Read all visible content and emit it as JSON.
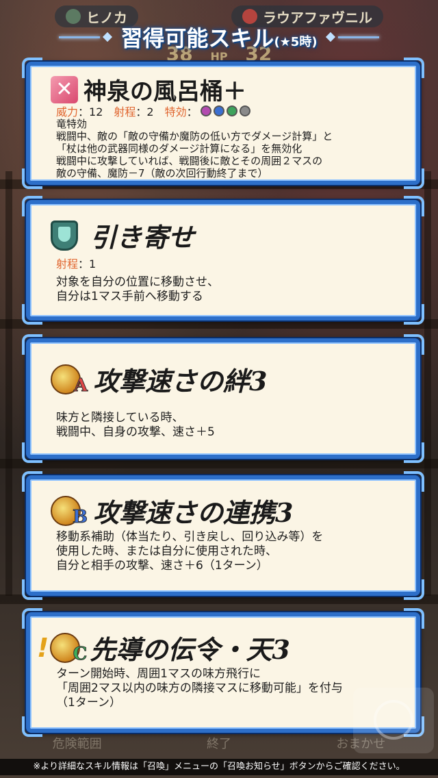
{
  "header": {
    "left_unit": "ヒノカ",
    "right_unit": "ラウアファヴニル",
    "hp_left": "38",
    "hp_label": "HP",
    "hp_right": "32",
    "title": "習得可能スキル",
    "title_suffix": "(★5時)"
  },
  "skills": [
    {
      "name": "神泉の風呂桶＋",
      "icon": "weapon-icon",
      "stats": {
        "might_label": "威力",
        "might": "12",
        "range_label": "射程",
        "range": "2",
        "effective_label": "特効"
      },
      "effect_icons": [
        "dragon-effective-icon",
        "armor-effective-icon",
        "cavalry-effective-icon",
        "flying-effective-icon"
      ],
      "desc": [
        "竜特効",
        "戦闘中、敵の「敵の守備か魔防の低い方でダメージ計算」と",
        "「杖は他の武器同様のダメージ計算になる」を無効化",
        "戦闘中に攻撃していれば、戦闘後に敵とその周囲２マスの",
        "敵の守備、魔防－7（敵の次回行動終了まで）"
      ]
    },
    {
      "name": "引き寄せ",
      "icon": "shield-icon",
      "stats": {
        "range_label": "射程",
        "range": "1"
      },
      "desc": [
        "対象を自分の位置に移動させ、",
        "自分は1マス手前へ移動する"
      ]
    },
    {
      "name": "攻撃速さの絆3",
      "icon": "passive-a-icon",
      "slot": "A",
      "desc": [
        "味方と隣接している時、",
        "戦闘中、自身の攻撃、速さ＋5"
      ]
    },
    {
      "name": "攻撃速さの連携3",
      "icon": "passive-b-icon",
      "slot": "B",
      "desc": [
        "移動系補助（体当たり、引き戻し、回り込み等）を",
        "使用した時、または自分に使用された時、",
        "自分と相手の攻撃、速さ＋6（1ターン）"
      ]
    },
    {
      "name": "先導の伝令・天3",
      "icon": "passive-c-icon",
      "slot": "C",
      "desc": [
        "ターン開始時、周囲1マスの味方飛行に",
        "「周囲2マス以内の味方の隣接マスに移動可能」を付与",
        "（1ターン）"
      ]
    }
  ],
  "footer": {
    "tabs": [
      "危険範囲",
      "終了",
      "おまかせ"
    ],
    "note": "※より詳細なスキル情報は「召喚」メニューの「召喚お知らせ」ボタンからご確認ください。"
  },
  "colors": {
    "card_border": "#2d6fc9",
    "card_bg": "#fbf5e5",
    "stat_label": "#e0652f"
  }
}
